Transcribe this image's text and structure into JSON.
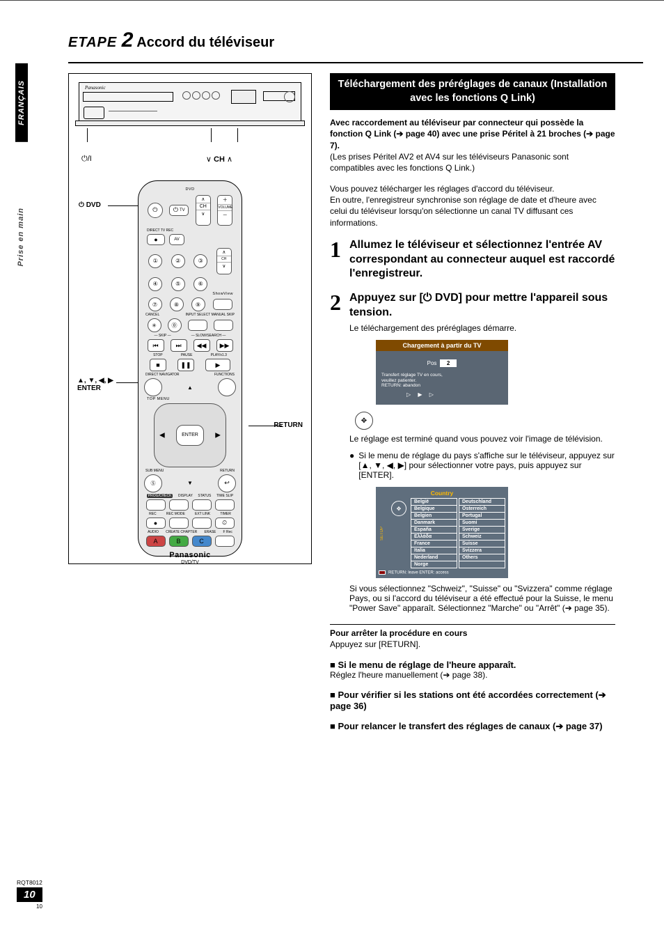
{
  "tabs": {
    "lang": "FRANÇAIS",
    "section": "Prise en main"
  },
  "heading": {
    "step_label": "ETAPE ",
    "step_num": "2",
    "title": " Accord du téléviseur"
  },
  "recorder_callouts": {
    "power": "/I",
    "ch": "CH"
  },
  "remote": {
    "label_dvd": "DVD",
    "tv_label": "TV",
    "direct_rec": "DIRECT TV REC",
    "av_label": "AV",
    "vol_label": "VOLUME",
    "ch_label": "CH",
    "showview": "ShowView",
    "row_cancel": "CANCEL",
    "row_input": "INPUT SELECT  MANUAL SKIP",
    "skip_label": "SKIP",
    "slow_label": "SLOW/SEARCH",
    "stop": "STOP",
    "pause": "PAUSE",
    "play": "PLAY/x1.3",
    "dir_nav": "DIRECT NAVIGATOR",
    "functions": "FUNCTIONS",
    "top_menu": "TOP MENU",
    "sub_menu": "SUB MENU",
    "return_label": "RETURN",
    "enter": "ENTER",
    "progcheck": "PROG/CHECK",
    "display": "DISPLAY",
    "status": "STATUS",
    "timeslip": "TIME SLIP",
    "rec": "REC",
    "recmode": "REC MODE",
    "extlink": "EXT LINK",
    "timer": "TIMER",
    "audio": "AUDIO",
    "chapter": "CREATE CHAPTER",
    "erase": "ERASE",
    "frec": "F Rec",
    "abc": {
      "a": "A",
      "b": "B",
      "c": "C"
    },
    "brand": "Panasonic",
    "subbrand": "DVD/TV",
    "callout_dvd": "⏻ DVD",
    "callout_nav": "▲, ▼, ◀, ▶\nENTER",
    "callout_return": "RETURN"
  },
  "right": {
    "section_bar": "Téléchargement des préréglages de canaux (Installation avec les fonctions Q Link)",
    "para1_bold": "Avec raccordement au téléviseur par connecteur qui possède la fonction Q Link (➔ page 40) avec une prise Péritel à 21 broches (➔ page 7).",
    "para1_note": "(Les prises Péritel AV2 et AV4 sur les téléviseurs Panasonic sont compatibles avec les fonctions Q Link.)",
    "para2": "Vous pouvez télécharger les réglages d'accord du téléviseur.\nEn outre, l'enregistreur synchronise son réglage de date et d'heure avec celui du téléviseur lorsqu'on sélectionne un canal TV diffusant ces informations.",
    "step1": "Allumez le téléviseur et sélectionnez l'entrée AV correspondant au connecteur auquel est raccordé l'enregistreur.",
    "step2": "Appuyez sur [⏻ DVD] pour mettre l'appareil sous tension.",
    "step2_sub": "Le téléchargement des préréglages démarre.",
    "osd": {
      "title": "Chargement à partir du TV",
      "pos_label": "Pos",
      "pos_value": "2",
      "msg": "Transfert réglage TV en cours,\nveuillez patienter.\nRETURN: abandon",
      "arrows": "▷ ▶ ▷"
    },
    "after_osd1": "Le réglage est terminé quand vous pouvez voir l'image de télévision.",
    "bullet1": "Si le menu de réglage du pays s'affiche sur le téléviseur, appuyez sur [▲, ▼, ◀, ▶] pour sélectionner votre pays, puis appuyez sur [ENTER].",
    "country": {
      "title": "Country",
      "setup_side": "SETUP",
      "col1": [
        "België",
        "Belgique",
        "Belgien",
        "Danmark",
        "España",
        "Eλλάδα",
        "France",
        "Italia",
        "Nederland",
        "Norge"
      ],
      "col2": [
        "Deutschland",
        "Österreich",
        "Portugal",
        "Suomi",
        "Sverige",
        "Schweiz",
        "Suisse",
        "Svizzera",
        "Others",
        ""
      ],
      "footer": "RETURN: leave   ENTER: access"
    },
    "after_country": "Si vous sélectionnez \"Schweiz\", \"Suisse\" ou \"Svizzera\" comme réglage Pays, ou si l'accord du téléviseur a été effectué pour la Suisse, le menu \"Power Save\" apparaît. Sélectionnez \"Marche\" ou \"Arrêt\" (➔ page 35).",
    "stop_heading": "Pour arrêter la procédure en cours",
    "stop_body": "Appuyez sur [RETURN].",
    "sq1_head": "Si le menu de réglage de l'heure apparaît.",
    "sq1_body": "Réglez l'heure manuellement (➔ page 38).",
    "sq2": "Pour vérifier si les stations ont été accordées correctement (➔ page 36)",
    "sq3": "Pour relancer le transfert des réglages de canaux (➔ page 37)"
  },
  "footer": {
    "code": "RQT8012",
    "page": "10",
    "mini": "10"
  }
}
